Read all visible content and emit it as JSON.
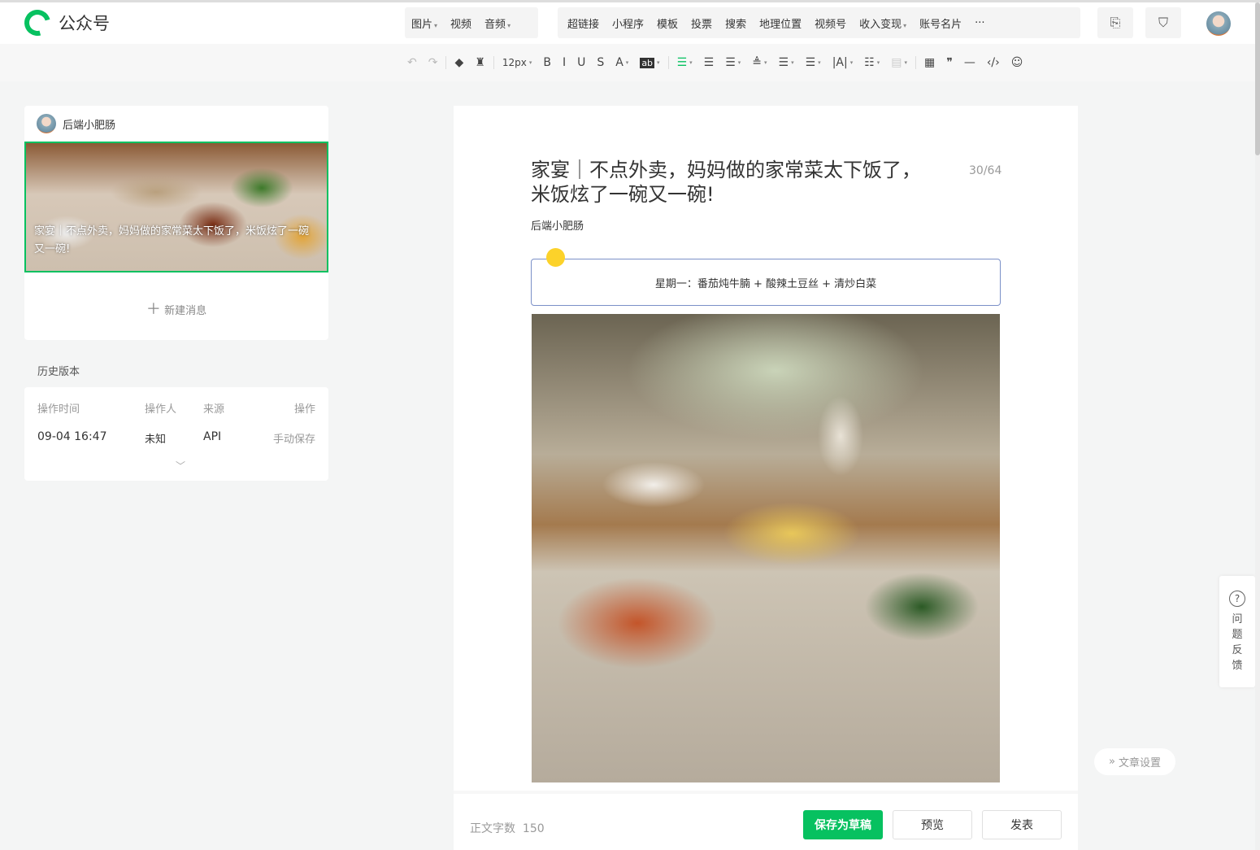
{
  "header": {
    "app_name": "公众号",
    "insert_group_1": [
      {
        "label": "图片",
        "dropdown": true
      },
      {
        "label": "视频",
        "dropdown": false
      },
      {
        "label": "音频",
        "dropdown": true
      }
    ],
    "insert_group_2": [
      {
        "label": "超链接",
        "dropdown": false
      },
      {
        "label": "小程序",
        "dropdown": false
      },
      {
        "label": "模板",
        "dropdown": false
      },
      {
        "label": "投票",
        "dropdown": false
      },
      {
        "label": "搜索",
        "dropdown": false
      },
      {
        "label": "地理位置",
        "dropdown": false
      },
      {
        "label": "视频号",
        "dropdown": false
      },
      {
        "label": "收入变现",
        "dropdown": true
      },
      {
        "label": "账号名片",
        "dropdown": false
      },
      {
        "label": "···",
        "dropdown": false
      }
    ],
    "icons": [
      "import-doc-icon",
      "security-check-icon",
      "user-avatar"
    ]
  },
  "toolbar": {
    "font_size": "12px",
    "items": [
      {
        "name": "undo-icon",
        "glyph": "↶"
      },
      {
        "name": "redo-icon",
        "glyph": "↷"
      },
      {
        "name": "sep"
      },
      {
        "name": "eraser-icon",
        "glyph": "◆"
      },
      {
        "name": "format-painter-icon",
        "glyph": "♜"
      },
      {
        "name": "sep"
      },
      {
        "name": "font-size",
        "glyph": "12px",
        "dd": true
      },
      {
        "name": "bold-icon",
        "glyph": "B"
      },
      {
        "name": "italic-icon",
        "glyph": "I"
      },
      {
        "name": "underline-icon",
        "glyph": "U"
      },
      {
        "name": "strikethrough-icon",
        "glyph": "S"
      },
      {
        "name": "font-color-icon",
        "glyph": "A",
        "dd": true
      },
      {
        "name": "background-color-icon",
        "glyph": "ab",
        "dd": true
      },
      {
        "name": "sep"
      },
      {
        "name": "align-center-icon",
        "glyph": "☰",
        "dd": true,
        "active": true
      },
      {
        "name": "indent-icon",
        "glyph": "☰"
      },
      {
        "name": "justify-icon",
        "glyph": "☰",
        "dd": true
      },
      {
        "name": "paragraph-spacing-before-icon",
        "glyph": "≜",
        "dd": true
      },
      {
        "name": "paragraph-spacing-after-icon",
        "glyph": "☰",
        "dd": true
      },
      {
        "name": "line-height-icon",
        "glyph": "☰",
        "dd": true
      },
      {
        "name": "letter-spacing-icon",
        "glyph": "|A|",
        "dd": true
      },
      {
        "name": "list-icon",
        "glyph": "☷",
        "dd": true
      },
      {
        "name": "block-style-icon",
        "glyph": "▤",
        "dd": true,
        "disabled": true
      },
      {
        "name": "sep"
      },
      {
        "name": "table-icon",
        "glyph": "▦"
      },
      {
        "name": "quote-icon",
        "glyph": "❞"
      },
      {
        "name": "divider-icon",
        "glyph": "—"
      },
      {
        "name": "code-icon",
        "glyph": "‹/›"
      },
      {
        "name": "emoji-icon",
        "glyph": "☺"
      }
    ]
  },
  "colors": {
    "accent": "#07c160",
    "box_border": "#7b90c8"
  },
  "left": {
    "account_name": "后端小肥肠",
    "cover_title": "家宴｜不点外卖，妈妈做的家常菜太下饭了，米饭炫了一碗又一碗!",
    "new_message": "新建消息"
  },
  "history": {
    "title": "历史版本",
    "headers": [
      "操作时间",
      "操作人",
      "来源",
      "操作"
    ],
    "rows": [
      [
        "09-04 16:47",
        "未知",
        "API",
        "手动保存"
      ]
    ]
  },
  "article": {
    "title": "家宴｜不点外卖，妈妈做的家常菜太下饭了，米饭炫了一碗又一碗!",
    "title_count": "30/64",
    "author": "后端小肥肠",
    "menu_line": "星期一：番茄炖牛腩 + 酸辣土豆丝 + 清炒白菜"
  },
  "footer": {
    "word_count_label": "正文字数",
    "word_count": "150",
    "save_draft": "保存为草稿",
    "preview": "预览",
    "publish": "发表"
  },
  "side": {
    "feedback": [
      "问",
      "题",
      "反",
      "馈"
    ],
    "article_settings": "文章设置"
  }
}
